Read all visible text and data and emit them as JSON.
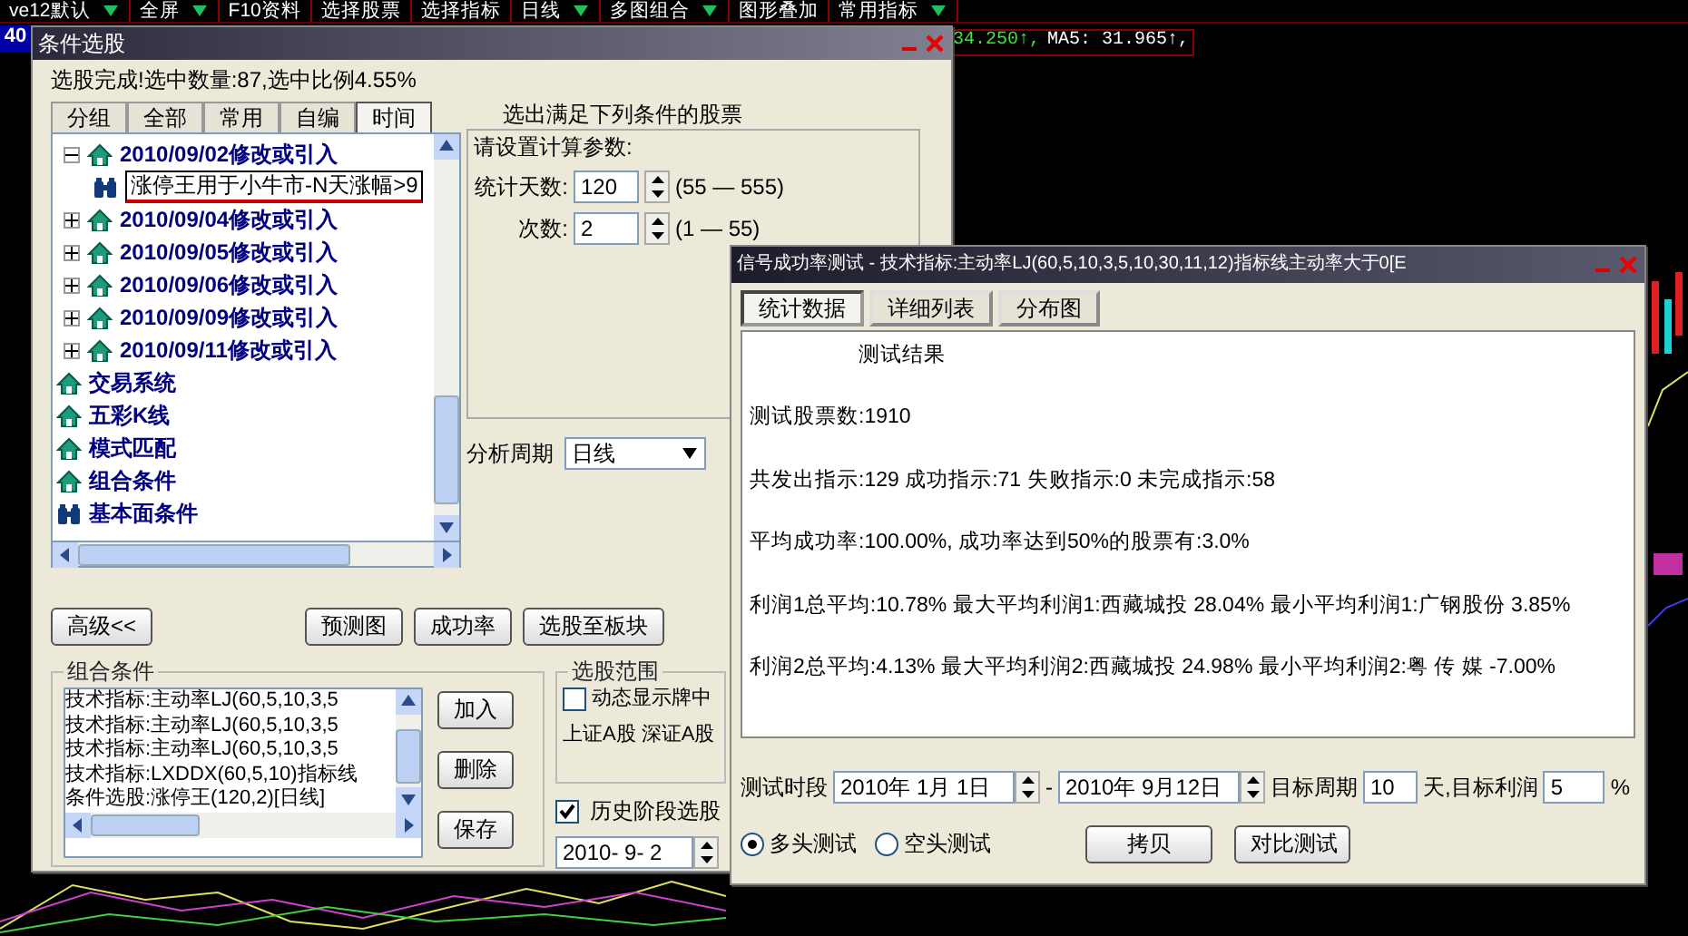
{
  "toolbar": {
    "items": [
      {
        "label": "ve12默认",
        "dropdown": true
      },
      {
        "label": "全屏",
        "dropdown": true
      },
      {
        "label": "F10资料",
        "dropdown": false
      },
      {
        "label": "选择股票",
        "dropdown": false
      },
      {
        "label": "选择指标",
        "dropdown": false
      },
      {
        "label": "日线",
        "dropdown": true
      },
      {
        "label": "多图组合",
        "dropdown": true
      },
      {
        "label": "图形叠加",
        "dropdown": false
      },
      {
        "label": "常用指标",
        "dropdown": true
      }
    ]
  },
  "quote_strip": {
    "code": "40",
    "price": "34.250↑,",
    "ma5": "MA5: 31.965↑,"
  },
  "stock_picker": {
    "title": "条件选股",
    "status": "选股完成!选中数量:87,选中比例4.55%",
    "tabs": [
      {
        "label": "分组",
        "selected": false
      },
      {
        "label": "全部",
        "selected": false
      },
      {
        "label": "常用",
        "selected": false
      },
      {
        "label": "自编",
        "selected": false
      },
      {
        "label": "时间",
        "selected": true
      }
    ],
    "tree": [
      {
        "label": "2010/09/02修改或引入",
        "kind": "date",
        "expanded": true,
        "children": [
          {
            "label": "涨停王用于小牛市-N天涨幅>9",
            "kind": "formula",
            "selected": true
          }
        ]
      },
      {
        "label": "2010/09/04修改或引入",
        "kind": "date",
        "expanded": false
      },
      {
        "label": "2010/09/05修改或引入",
        "kind": "date",
        "expanded": false
      },
      {
        "label": "2010/09/06修改或引入",
        "kind": "date",
        "expanded": false
      },
      {
        "label": "2010/09/09修改或引入",
        "kind": "date",
        "expanded": false
      },
      {
        "label": "2010/09/11修改或引入",
        "kind": "date",
        "expanded": false
      },
      {
        "label": "交易系统",
        "kind": "category"
      },
      {
        "label": "五彩K线",
        "kind": "category"
      },
      {
        "label": "模式匹配",
        "kind": "category"
      },
      {
        "label": "组合条件",
        "kind": "category"
      },
      {
        "label": "基本面条件",
        "kind": "formula"
      }
    ],
    "heading": "选出满足下列条件的股票",
    "params_title": "请设置计算参数:",
    "params": [
      {
        "label": "统计天数:",
        "value": "120",
        "range": "(55 — 555)"
      },
      {
        "label": "次数:",
        "value": "2",
        "range": "(1 — 55)"
      }
    ],
    "period": {
      "label": "分析周期",
      "value": "日线"
    },
    "buttons": [
      "高级<<",
      "预测图",
      "成功率",
      "选股至板块"
    ],
    "combo": {
      "title": "组合条件",
      "items": [
        "技术指标:主动率LJ(60,5,10,3,5",
        "技术指标:主动率LJ(60,5,10,3,5",
        "技术指标:主动率LJ(60,5,10,3,5",
        "技术指标:LXDDX(60,5,10)指标线",
        "条件选股:涨停王(120,2)[日线]"
      ],
      "buttons": [
        "加入",
        "删除",
        "保存"
      ]
    },
    "scope": {
      "title": "选股范围",
      "dynamic": {
        "label": "动态显示牌中",
        "checked": false
      },
      "markets": "上证A股 深证A股",
      "history": {
        "label": "历史阶段选股",
        "checked": true
      },
      "date": "2010- 9- 2"
    }
  },
  "success_test": {
    "title": "信号成功率测试 - 技术指标:主动率LJ(60,5,10,3,5,10,30,11,12)指标线主动率大于0[E",
    "tabs": [
      {
        "label": "统计数据",
        "selected": true
      },
      {
        "label": "详细列表",
        "selected": false
      },
      {
        "label": "分布图",
        "selected": false
      }
    ],
    "result_title": "测试结果",
    "results": [
      "测试股票数:1910",
      "共发出指示:129 成功指示:71 失败指示:0 未完成指示:58",
      "平均成功率:100.00%, 成功率达到50%的股票有:3.0%",
      "利润1总平均:10.78% 最大平均利润1:西藏城投 28.04% 最小平均利润1:广钢股份 3.85%",
      "利润2总平均:4.13% 最大平均利润2:西藏城投 24.98% 最小平均利润2:粤 传 媒 -7.00%"
    ],
    "period_label": "测试时段",
    "start": "2010年 1月 1日",
    "dash": "-",
    "end": "2010年 9月12日",
    "target_period_label": "目标周期",
    "target_period": "10",
    "target_profit_label": "天,目标利润",
    "target_profit": "5",
    "percent": "%",
    "modes": [
      {
        "label": "多头测试",
        "selected": true
      },
      {
        "label": "空头测试",
        "selected": false
      }
    ],
    "buttons": [
      "拷贝",
      "对比测试"
    ]
  }
}
